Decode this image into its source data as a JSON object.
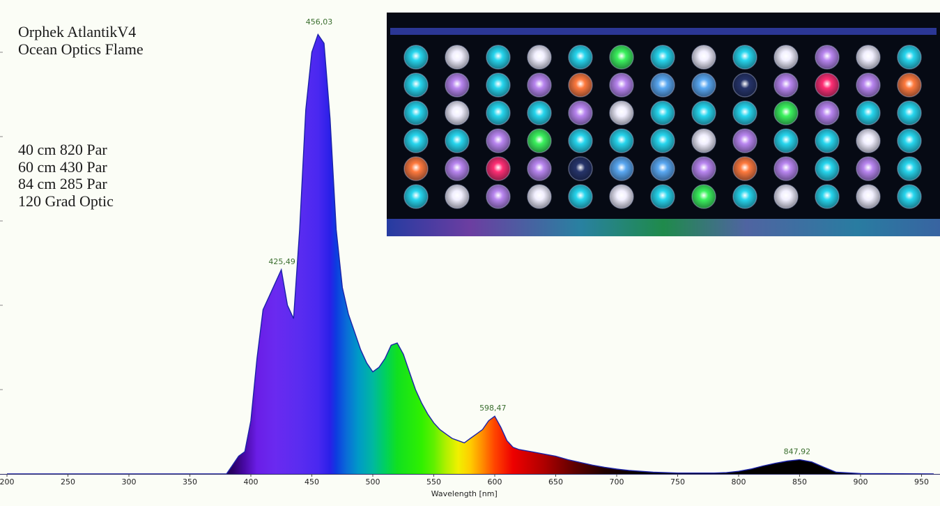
{
  "annotations": {
    "top_lines": [
      "Orphek AtlantikV4",
      "Ocean Optics Flame"
    ],
    "bottom_lines": [
      "40 cm 820 Par",
      "60 cm 430 Par",
      "84 cm 285 Par",
      "120 Grad Optic"
    ]
  },
  "colors": {
    "background": "#fbfdf6",
    "peak_label": "#3a6e2e",
    "outline": "#1b22a8",
    "photo_background": "#060a14"
  },
  "photo": {
    "rows": [
      [
        "cyan",
        "white",
        "cyan",
        "white",
        "cyan",
        "green",
        "cyan",
        "white",
        "cyan",
        "white",
        "violet",
        "white",
        "cyan"
      ],
      [
        "cyan",
        "violet",
        "cyan",
        "violet",
        "orange",
        "violet",
        "blue",
        "blue",
        "dark",
        "violet",
        "red",
        "violet",
        "orange"
      ],
      [
        "cyan",
        "white",
        "cyan",
        "cyan",
        "violet",
        "white",
        "cyan",
        "cyan",
        "cyan",
        "green",
        "violet",
        "cyan",
        "cyan"
      ],
      [
        "cyan",
        "cyan",
        "violet",
        "green",
        "cyan",
        "cyan",
        "cyan",
        "white",
        "violet",
        "cyan",
        "cyan",
        "white",
        "cyan"
      ],
      [
        "orange",
        "violet",
        "red",
        "violet",
        "dark",
        "blue",
        "blue",
        "violet",
        "orange",
        "violet",
        "cyan",
        "violet",
        "cyan"
      ],
      [
        "cyan",
        "white",
        "violet",
        "white",
        "cyan",
        "white",
        "cyan",
        "green",
        "cyan",
        "white",
        "cyan",
        "white",
        "cyan"
      ]
    ],
    "led_colors": {
      "cyan": "#27d6ee",
      "white": "#f2f0ff",
      "violet": "#b986f0",
      "blue": "#5aa8f2",
      "green": "#3cf25e",
      "orange": "#ff7a3e",
      "red": "#ff2e74",
      "dark": "#26346a"
    }
  },
  "chart_data": {
    "type": "area",
    "xlabel": "Wavelength [nm]",
    "ylabel": "",
    "xlim": [
      200,
      960
    ],
    "ylim": [
      0,
      1
    ],
    "x_ticks": [
      200,
      250,
      300,
      350,
      400,
      450,
      500,
      550,
      600,
      650,
      700,
      750,
      800,
      850,
      900,
      950
    ],
    "peaks": [
      {
        "label": "425,49",
        "x": 425.49,
        "y": 0.46
      },
      {
        "label": "456,03",
        "x": 456.03,
        "y": 1.0
      },
      {
        "label": "598,47",
        "x": 598.47,
        "y": 0.13
      },
      {
        "label": "847,92",
        "x": 847.92,
        "y": 0.032
      }
    ],
    "series": [
      {
        "x": [
          200,
          380,
          385,
          390,
          395,
          400,
          405,
          410,
          415,
          420,
          425,
          430,
          435,
          440,
          445,
          450,
          455,
          460,
          465,
          470,
          475,
          480,
          485,
          490,
          495,
          500,
          505,
          510,
          515,
          520,
          525,
          530,
          535,
          540,
          545,
          550,
          555,
          560,
          565,
          570,
          575,
          580,
          585,
          590,
          595,
          600,
          605,
          610,
          615,
          620,
          630,
          640,
          650,
          660,
          670,
          680,
          690,
          700,
          710,
          720,
          730,
          740,
          750,
          760,
          770,
          780,
          790,
          800,
          810,
          820,
          830,
          840,
          850,
          860,
          870,
          880,
          900,
          960
        ],
        "y": [
          0.0,
          0.0,
          0.02,
          0.04,
          0.05,
          0.12,
          0.26,
          0.37,
          0.4,
          0.43,
          0.46,
          0.38,
          0.35,
          0.55,
          0.82,
          0.95,
          0.99,
          0.97,
          0.8,
          0.55,
          0.42,
          0.36,
          0.32,
          0.28,
          0.25,
          0.23,
          0.24,
          0.26,
          0.29,
          0.295,
          0.27,
          0.23,
          0.19,
          0.16,
          0.135,
          0.115,
          0.1,
          0.09,
          0.08,
          0.075,
          0.07,
          0.08,
          0.09,
          0.1,
          0.12,
          0.13,
          0.105,
          0.075,
          0.06,
          0.055,
          0.05,
          0.045,
          0.04,
          0.032,
          0.026,
          0.02,
          0.015,
          0.011,
          0.008,
          0.006,
          0.004,
          0.003,
          0.002,
          0.002,
          0.002,
          0.002,
          0.003,
          0.006,
          0.011,
          0.018,
          0.024,
          0.029,
          0.032,
          0.027,
          0.015,
          0.004,
          0.001,
          0.0
        ]
      }
    ]
  }
}
